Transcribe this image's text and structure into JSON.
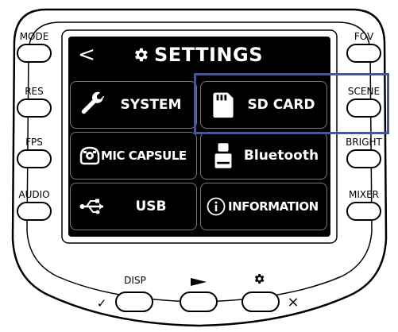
{
  "screen": {
    "back_glyph": "<",
    "title": "SETTINGS",
    "title_icon": "gear-icon",
    "tiles": [
      {
        "label": "SYSTEM",
        "icon": "wrench-icon"
      },
      {
        "label": "SD CARD",
        "icon": "sd-card-icon"
      },
      {
        "label": "MIC CAPSULE",
        "icon": "mic-capsule-icon"
      },
      {
        "label": "Bluetooth",
        "icon": "bluetooth-adapter-icon"
      },
      {
        "label": "USB",
        "icon": "usb-icon"
      },
      {
        "label": "INFORMATION",
        "icon": "info-icon"
      }
    ],
    "selected": "SD CARD"
  },
  "left_buttons": [
    "MODE",
    "RES",
    "FPS",
    "AUDIO"
  ],
  "right_buttons": [
    "FOV",
    "SCENE",
    "BRIGHT",
    "MIXER"
  ],
  "bottom_buttons": {
    "disp": "DISP",
    "play_icon": "play-icon",
    "settings_icon": "gear-icon",
    "confirm_glyph": "✓",
    "cancel_glyph": "×"
  },
  "colors": {
    "screen_bg": "#000000",
    "tile_border": "#7a7a7a",
    "highlight": "#4a5690"
  }
}
